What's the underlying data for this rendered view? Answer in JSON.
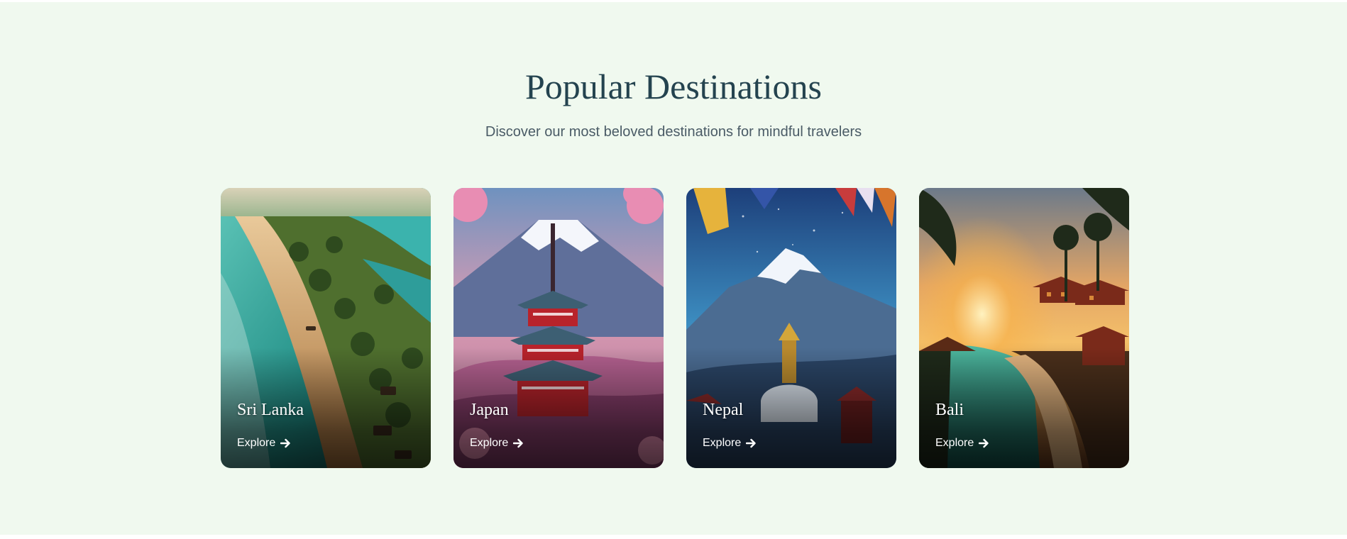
{
  "header": {
    "title": "Popular Destinations",
    "subtitle": "Discover our most beloved destinations for mindful travelers"
  },
  "colors": {
    "background": "#f0f9ef",
    "title": "#24434f",
    "subtitle": "#4a5b66"
  },
  "destinations": [
    {
      "name": "Sri Lanka",
      "link_label": "Explore",
      "icon": "arrow-right-icon"
    },
    {
      "name": "Japan",
      "link_label": "Explore",
      "icon": "arrow-right-icon"
    },
    {
      "name": "Nepal",
      "link_label": "Explore",
      "icon": "arrow-right-icon"
    },
    {
      "name": "Bali",
      "link_label": "Explore",
      "icon": "arrow-right-icon"
    }
  ]
}
